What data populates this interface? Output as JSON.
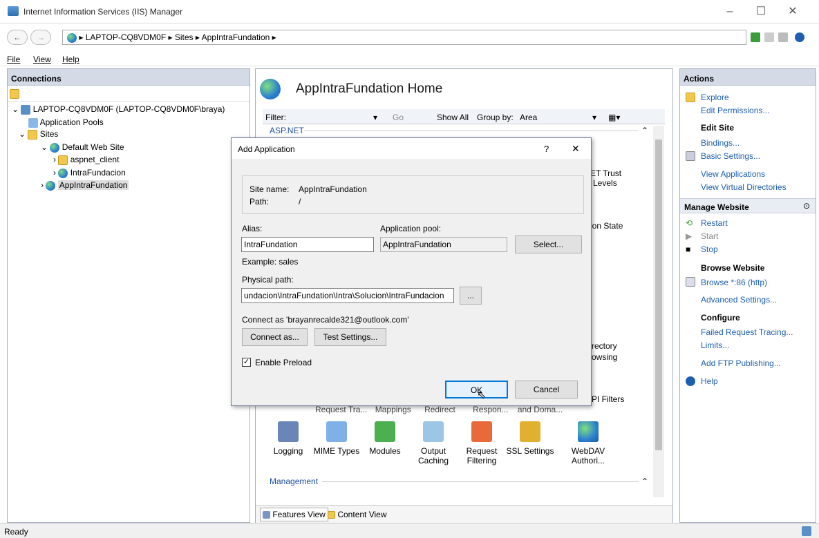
{
  "window": {
    "title": "Internet Information Services (IIS) Manager"
  },
  "address": {
    "path": "▸ LAPTOP-CQ8VDM0F ▸ Sites ▸ AppIntraFundation ▸"
  },
  "menu": {
    "file": "File",
    "view": "View",
    "help": "Help"
  },
  "connections": {
    "header": "Connections",
    "items": [
      {
        "label": "LAPTOP-CQ8VDM0F (LAPTOP-CQ8VDM0F\\braya)"
      },
      {
        "label": "Application Pools"
      },
      {
        "label": "Sites"
      },
      {
        "label": "Default Web Site"
      },
      {
        "label": "aspnet_client"
      },
      {
        "label": "IntraFundacion"
      },
      {
        "label": "AppIntraFundation"
      }
    ]
  },
  "center": {
    "title": "AppIntraFundation Home",
    "filter_label": "Filter:",
    "go": "Go",
    "show_all": "Show All",
    "group_by": "Group by:",
    "group_value": "Area",
    "section_aspnet": "ASP.NET",
    "section_mgmt": "Management",
    "partial": {
      "trust": "ET Trust",
      "levels": "Levels",
      "session": "ion State",
      "dir1": "rectory",
      "dir2": "owsing",
      "isapi": "PI Filters",
      "req": "Request Tra...",
      "map": "Mappings",
      "redir": "Redirect",
      "resp": "Respon...",
      "dom": "and Doma..."
    },
    "features": [
      {
        "line1": "Logging",
        "line2": ""
      },
      {
        "line1": "MIME Types",
        "line2": ""
      },
      {
        "line1": "Modules",
        "line2": ""
      },
      {
        "line1": "Output",
        "line2": "Caching"
      },
      {
        "line1": "Request",
        "line2": "Filtering"
      },
      {
        "line1": "SSL Settings",
        "line2": ""
      },
      {
        "line1": "WebDAV",
        "line2": "Authori..."
      }
    ],
    "features_view": "Features View",
    "content_view": "Content View"
  },
  "actions": {
    "header": "Actions",
    "explore": "Explore",
    "edit_perm": "Edit Permissions...",
    "edit_site": "Edit Site",
    "bindings": "Bindings...",
    "basic": "Basic Settings...",
    "view_apps": "View Applications",
    "view_vdirs": "View Virtual Directories",
    "manage": "Manage Website",
    "restart": "Restart",
    "start": "Start",
    "stop": "Stop",
    "browse_h": "Browse Website",
    "browse": "Browse *:86 (http)",
    "advanced": "Advanced Settings...",
    "configure": "Configure",
    "failed": "Failed Request Tracing...",
    "limits": "Limits...",
    "ftp": "Add FTP Publishing...",
    "help": "Help"
  },
  "status": {
    "text": "Ready"
  },
  "dialog": {
    "title": "Add Application",
    "help": "?",
    "close": "✕",
    "site_name_label": "Site name:",
    "site_name": "AppIntraFundation",
    "path_label": "Path:",
    "path": "/",
    "alias_label": "Alias:",
    "alias": "IntraFundation",
    "pool_label": "Application pool:",
    "pool": "AppIntraFundation",
    "select": "Select...",
    "example": "Example: sales",
    "phys_label": "Physical path:",
    "phys": "undacion\\IntraFundation\\Intra\\Solucion\\IntraFundacion",
    "browse": "...",
    "connect_as_text": "Connect as 'brayanrecalde321@outlook.com'",
    "connect_as": "Connect as...",
    "test": "Test Settings...",
    "preload": "Enable Preload",
    "ok": "OK",
    "cancel": "Cancel"
  }
}
